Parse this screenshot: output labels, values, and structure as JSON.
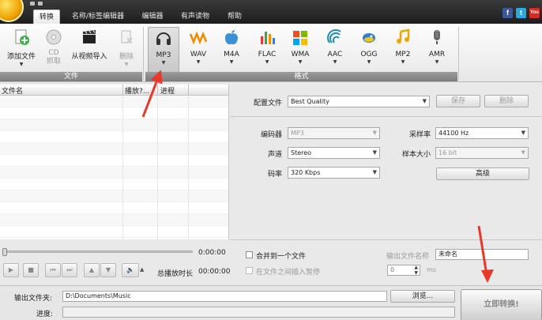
{
  "tabs": [
    {
      "label": "转换",
      "active": true
    },
    {
      "label": "名称/标签编辑器",
      "active": false
    },
    {
      "label": "编辑器",
      "active": false
    },
    {
      "label": "有声读物",
      "active": false
    },
    {
      "label": "帮助",
      "active": false
    }
  ],
  "social": {
    "facebook": "f",
    "twitter": "t",
    "youtube": "You"
  },
  "ribbon": {
    "file_group_label": "文件",
    "format_group_label": "格式",
    "add_file": "添加文件",
    "cd_rip_line1": "CD",
    "cd_rip_line2": "抓取",
    "import_video": "从视频导入",
    "delete": "删除",
    "formats": [
      "MP3",
      "WAV",
      "M4A",
      "FLAC",
      "WMA",
      "AAC",
      "OGG",
      "MP2",
      "AMR"
    ],
    "selected_format": "MP3"
  },
  "file_list": {
    "columns": {
      "name": "文件名",
      "play": "播放?...",
      "progress": "进程"
    }
  },
  "player": {
    "time_position": "0:00:00",
    "total_label": "总播放时长",
    "total_time": "00:00:00"
  },
  "settings": {
    "profile_label": "配置文件",
    "profile_value": "Best Quality",
    "save": "保存",
    "delete": "删除",
    "encoder_label": "编码器",
    "encoder_value": "MP3",
    "channel_label": "声道",
    "channel_value": "Stereo",
    "bitrate_label": "码率",
    "bitrate_value": "320 Kbps",
    "samplerate_label": "采样率",
    "samplerate_value": "44100 Hz",
    "samplesize_label": "样本大小",
    "samplesize_value": "16 bit",
    "advanced": "高级"
  },
  "merge": {
    "merge_label": "合并到一个文件",
    "pause_label": "在文件之间插入暂停",
    "output_name_label": "输出文件名称",
    "output_name_value": "未命名",
    "pause_value": "0",
    "pause_unit": "ms"
  },
  "bottom": {
    "output_folder_label": "输出文件夹:",
    "output_folder_value": "D:\\Documents\\Music",
    "browse": "浏览...",
    "progress_label": "进度:",
    "convert": "立即转换!"
  },
  "colors": {
    "annotation_arrow": "#e8372b",
    "facebook": "#3b5998",
    "twitter": "#29a9e1",
    "youtube": "#d62b27"
  }
}
